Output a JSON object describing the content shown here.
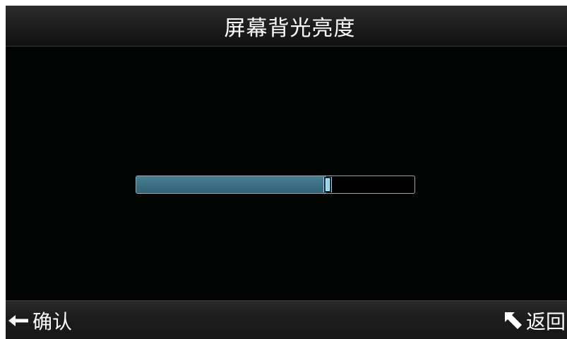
{
  "title": "屏幕背光亮度",
  "brightness": {
    "level_fraction": 0.683
  },
  "softkeys": {
    "confirm": {
      "icon": "enter-arrow-icon",
      "label": "确认"
    },
    "back": {
      "icon": "back-arrow-icon",
      "label": "返回"
    }
  },
  "colors": {
    "screen_bg": "#020403",
    "fill": "#3f7387",
    "thumb": "#8fd4f2",
    "text": "#ffffff"
  }
}
